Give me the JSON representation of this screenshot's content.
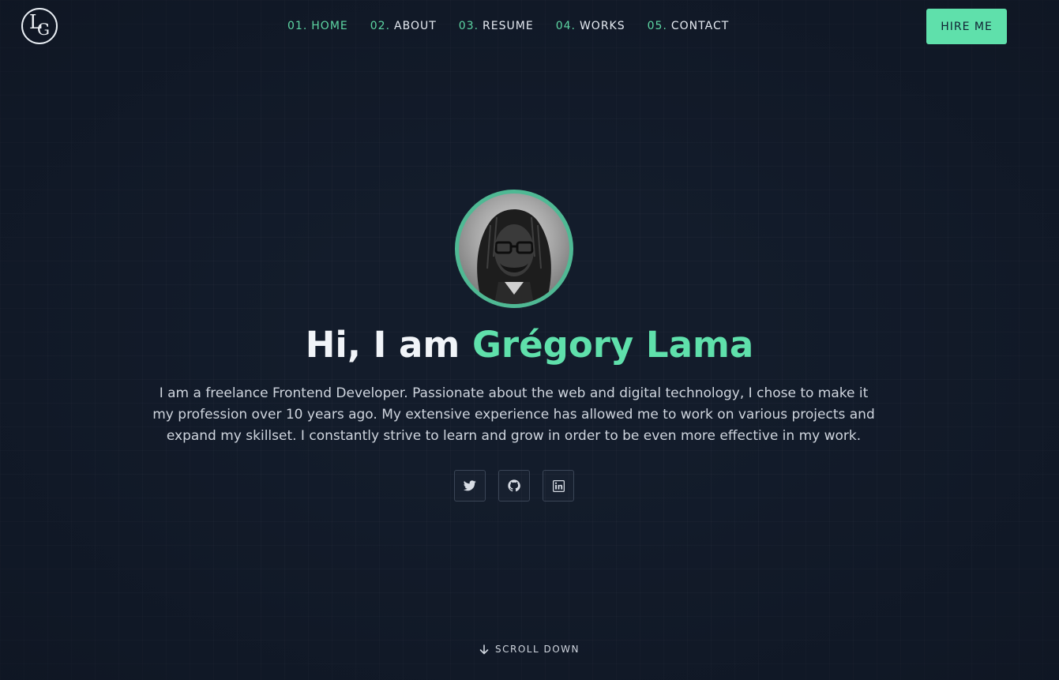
{
  "brand": {
    "logo_letters": "LG"
  },
  "nav": {
    "items": [
      {
        "num": "01.",
        "label": "HOME",
        "active": true
      },
      {
        "num": "02.",
        "label": "ABOUT",
        "active": false
      },
      {
        "num": "03.",
        "label": "RESUME",
        "active": false
      },
      {
        "num": "04.",
        "label": "WORKS",
        "active": false
      },
      {
        "num": "05.",
        "label": "CONTACT",
        "active": false
      }
    ],
    "hire_label": "HIRE ME"
  },
  "hero": {
    "greeting": "Hi, I am ",
    "name": "Grégory Lama",
    "bio": "I am a freelance Frontend Developer. Passionate about the web and digital technology, I chose to make it my profession over 10 years ago. My extensive experience has allowed me to work on various projects and expand my skillset. I constantly strive to learn and grow in order to be even more effective in my work.",
    "socials": [
      {
        "icon": "twitter-icon"
      },
      {
        "icon": "github-icon"
      },
      {
        "icon": "linkedin-icon"
      }
    ]
  },
  "scroll": {
    "label": "SCROLL DOWN",
    "icon": "arrow-down-icon"
  },
  "colors": {
    "background": "#131c2b",
    "accent": "#5fe0ab",
    "text": "#f1f4f8"
  }
}
